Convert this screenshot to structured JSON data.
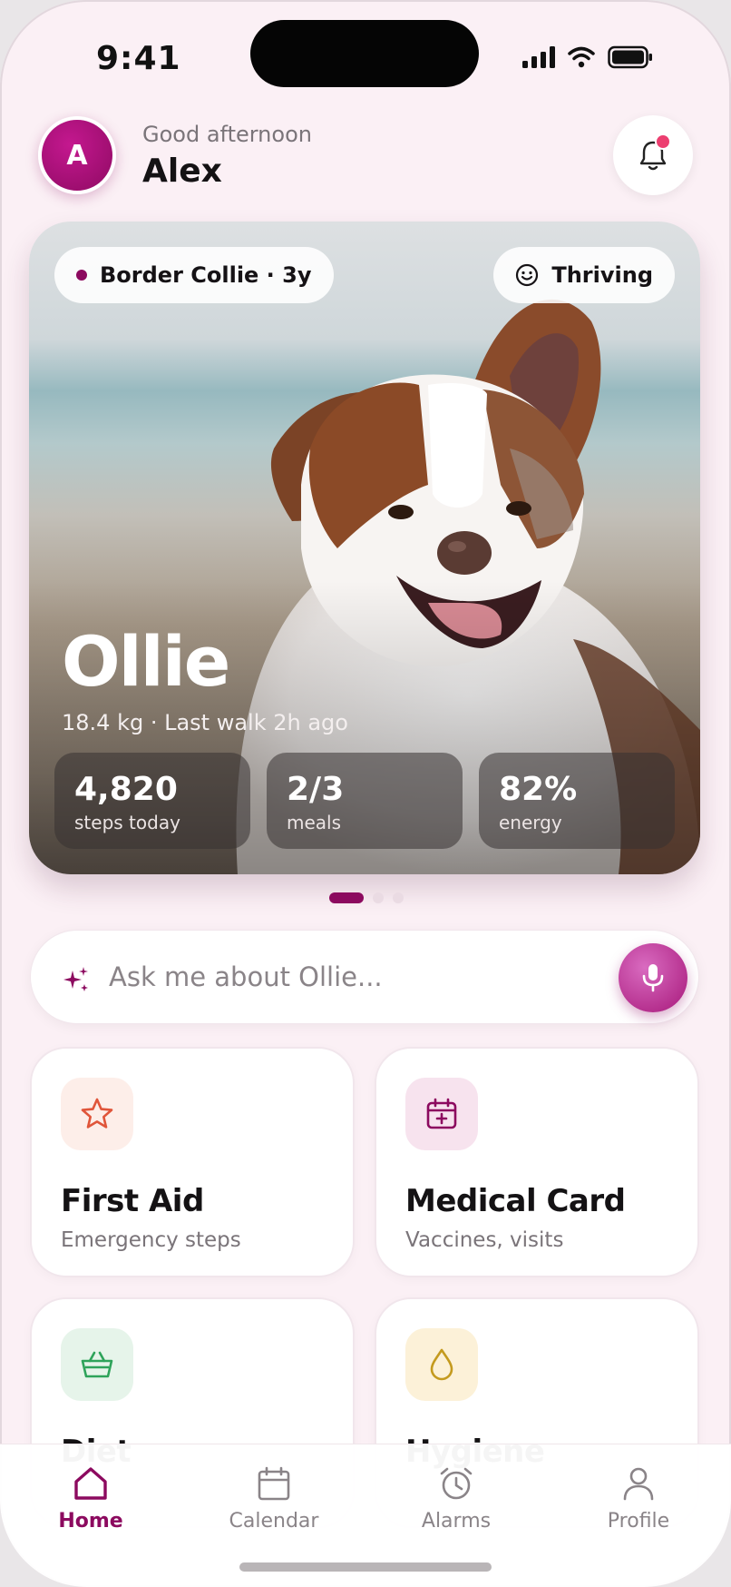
{
  "status_bar": {
    "time": "9:41"
  },
  "header": {
    "avatar_initial": "A",
    "greeting": "Good afternoon",
    "name": "Alex"
  },
  "hero": {
    "breed_chip": "Border Collie · 3y",
    "mood_chip": "Thriving",
    "pet_name": "Ollie",
    "subtitle": "18.4 kg · Last walk 2h ago",
    "stats": [
      {
        "value": "4,820",
        "label": "steps today"
      },
      {
        "value": "2/3",
        "label": "meals"
      },
      {
        "value": "82%",
        "label": "energy"
      }
    ]
  },
  "pager": {
    "pages": 3,
    "active": 1
  },
  "ask": {
    "placeholder": "Ask me about Ollie..."
  },
  "tiles": [
    {
      "title": "First Aid",
      "subtitle": "Emergency steps",
      "icon": "star-icon",
      "icon_bg": "#fdeee9",
      "icon_color": "#e0553a"
    },
    {
      "title": "Medical Card",
      "subtitle": "Vaccines, visits",
      "icon": "calendar-plus-icon",
      "icon_bg": "#f7e3ee",
      "icon_color": "#8c0a5f"
    },
    {
      "title": "Diet",
      "subtitle": "",
      "icon": "basket-icon",
      "icon_bg": "#e6f4ea",
      "icon_color": "#2ea35a"
    },
    {
      "title": "Hygiene",
      "subtitle": "",
      "icon": "droplet-icon",
      "icon_bg": "#fcf1d8",
      "icon_color": "#c49a1e"
    }
  ],
  "tabbar": {
    "tabs": [
      {
        "label": "Home",
        "icon": "home-icon",
        "active": true
      },
      {
        "label": "Calendar",
        "icon": "calendar-icon",
        "active": false
      },
      {
        "label": "Alarms",
        "icon": "alarm-clock-icon",
        "active": false
      },
      {
        "label": "Profile",
        "icon": "person-icon",
        "active": false
      }
    ]
  },
  "colors": {
    "accent": "#8c0a5f",
    "notification_dot": "#ec3f70",
    "background": "#fbf0f5"
  }
}
